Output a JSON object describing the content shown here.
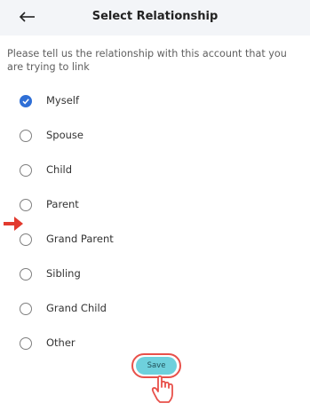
{
  "header": {
    "title": "Select Relationship",
    "back_icon": "arrow-left-icon"
  },
  "prompt": "Please tell us the relationship with this account that you are trying to link",
  "options": [
    {
      "label": "Myself",
      "checked": true
    },
    {
      "label": "Spouse",
      "checked": false
    },
    {
      "label": "Child",
      "checked": false
    },
    {
      "label": "Parent",
      "checked": false
    },
    {
      "label": "Grand Parent",
      "checked": false
    },
    {
      "label": "Sibling",
      "checked": false
    },
    {
      "label": "Grand Child",
      "checked": false
    },
    {
      "label": "Other",
      "checked": false
    }
  ],
  "save_label": "Save",
  "colors": {
    "header_bg": "#f3f5f8",
    "accent": "#2f6fd6",
    "save_button": "#6ed0dc",
    "annotation": "#e8504a"
  }
}
